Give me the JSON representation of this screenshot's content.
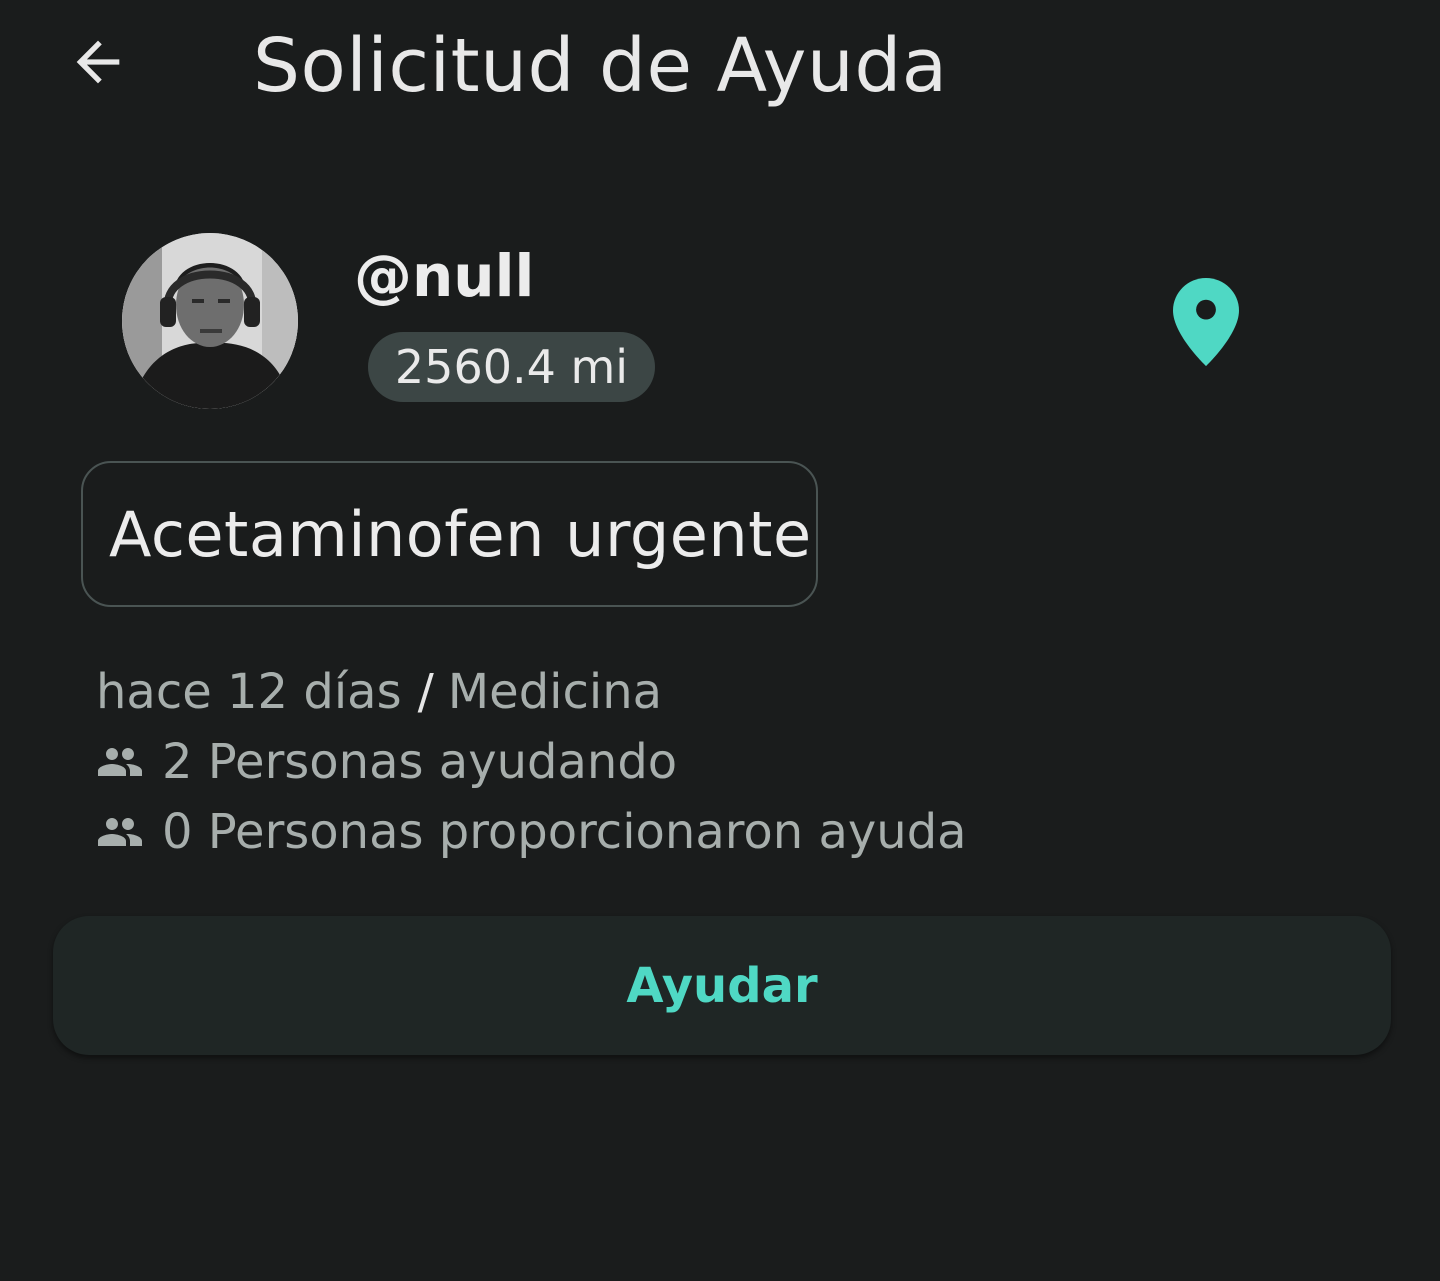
{
  "header": {
    "title": "Solicitud de Ayuda",
    "back_icon": "arrow-left-icon"
  },
  "user": {
    "username": "@null",
    "distance": "2560.4 mi",
    "location_icon": "map-pin-icon"
  },
  "request": {
    "title": "Acetaminofen urgente",
    "time_ago": "hace 12 días",
    "separator": "/",
    "category": "Medicina",
    "helping_text": "2 Personas ayudando",
    "provided_text": "0 Personas proporcionaron ayuda",
    "people_icon": "people-icon"
  },
  "actions": {
    "help_label": "Ayudar"
  },
  "colors": {
    "background": "#1a1c1c",
    "accent": "#4fd8c4",
    "chip": "#3c4645",
    "button_bg": "#1f2625"
  }
}
